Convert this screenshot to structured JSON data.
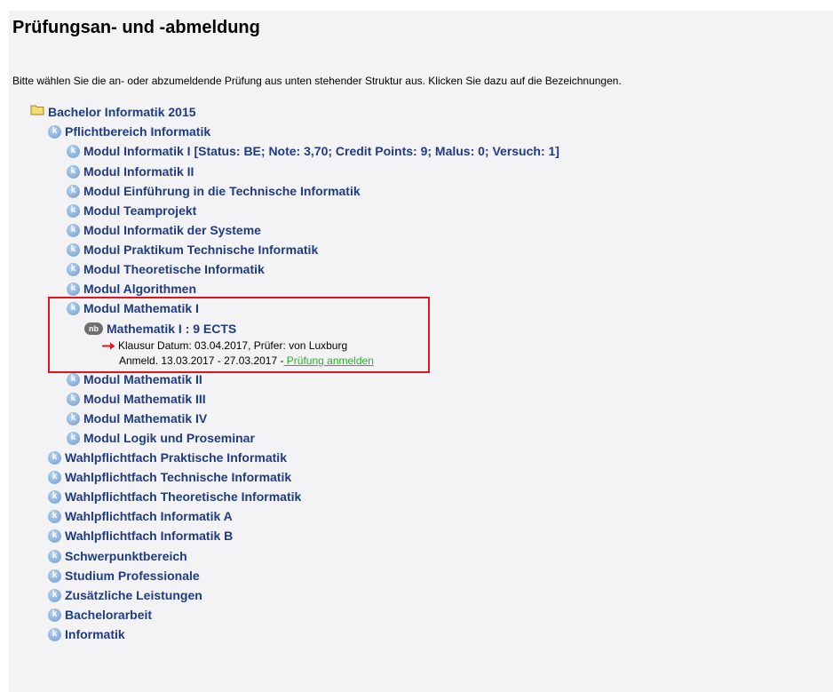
{
  "page": {
    "title": "Prüfungsan- und -abmeldung",
    "instructions": "Bitte wählen Sie die an- oder abzumeldende Prüfung aus unten stehender Struktur aus. Klicken Sie dazu auf die Bezeichnungen."
  },
  "icons": {
    "k_glyph": "k",
    "nb_glyph": "nb",
    "folder": "folder-icon",
    "arrow": "arrow-right-icon"
  },
  "tree": {
    "root": {
      "label": "Bachelor Informatik 2015"
    },
    "pflicht": {
      "label": "Pflichtbereich Informatik"
    },
    "modules_before": [
      "Modul Informatik I [Status: BE; Note: 3,70; Credit Points: 9; Malus: 0; Versuch: 1]",
      "Modul Informatik II",
      "Modul Einführung in die Technische Informatik",
      "Modul Teamprojekt",
      "Modul Informatik der Systeme",
      "Modul Praktikum Technische Informatik",
      "Modul Theoretische Informatik",
      "Modul Algorithmen"
    ],
    "highlighted": {
      "module": "Modul Mathematik I",
      "exam": "Mathematik I : 9 ECTS",
      "exam_info": "Klausur Datum: 03.04.2017, Prüfer: von Luxburg",
      "registration": "Anmeld. 13.03.2017 - 27.03.2017 -",
      "register_link": " Prüfung anmelden"
    },
    "modules_after": [
      "Modul Mathematik II",
      "Modul Mathematik III",
      "Modul Mathematik IV",
      "Modul Logik und Proseminar"
    ],
    "top_level": [
      "Wahlpflichtfach Praktische Informatik",
      "Wahlpflichtfach Technische Informatik",
      "Wahlpflichtfach Theoretische Informatik",
      "Wahlpflichtfach Informatik A",
      "Wahlpflichtfach Informatik B",
      "Schwerpunktbereich",
      "Studium Professionale",
      "Zusätzliche Leistungen",
      "Bachelorarbeit",
      "Informatik"
    ]
  },
  "colors": {
    "link": "#1f3c82",
    "highlight_border": "#e0141a",
    "register_link": "#2fae2f",
    "background": "#f3f3f5"
  }
}
